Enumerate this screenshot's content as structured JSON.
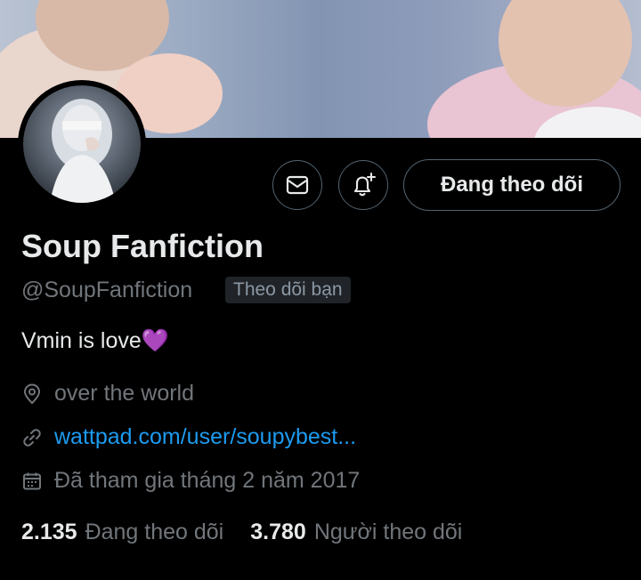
{
  "profile": {
    "name": "Soup Fanfiction",
    "handle": "@SoupFanfiction",
    "follows_you": "Theo dõi bạn",
    "bio": "Vmin is love",
    "bio_emoji": "💜",
    "location": "over the world",
    "website": "wattpad.com/user/soupybest...",
    "joined": "Đã tham gia tháng 2 năm 2017"
  },
  "actions": {
    "message_icon": "mail-icon",
    "notify_icon": "bell-plus-icon",
    "follow_label": "Đang theo dõi"
  },
  "stats": {
    "following_count": "2.135",
    "following_label": "Đang theo dõi",
    "followers_count": "3.780",
    "followers_label": "Người theo dõi"
  },
  "colors": {
    "background": "#000000",
    "text_primary": "#e7e9ea",
    "text_secondary": "#71767b",
    "link": "#1d9bf0",
    "border": "#536471"
  }
}
